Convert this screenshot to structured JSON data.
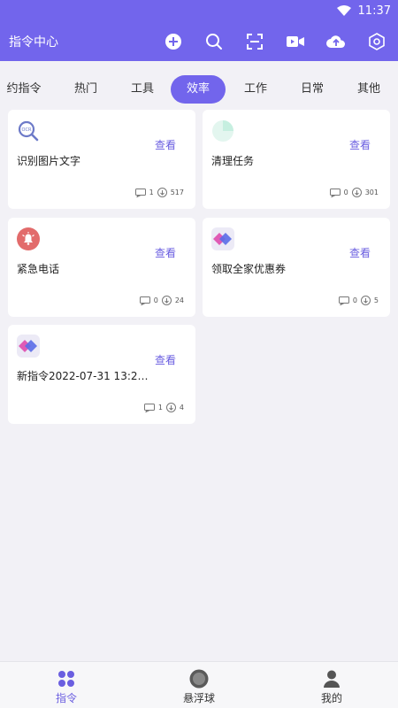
{
  "status_bar": {
    "time": "11:37",
    "wifi_icon": "wifi-icon"
  },
  "header": {
    "title": "指令中心",
    "icons": [
      "add-icon",
      "search-icon",
      "scan-icon",
      "video-icon",
      "cloud-upload-icon",
      "settings-icon"
    ]
  },
  "tabs": [
    {
      "label": "约指令"
    },
    {
      "label": "热门"
    },
    {
      "label": "工具"
    },
    {
      "label": "效率",
      "active": true
    },
    {
      "label": "工作"
    },
    {
      "label": "日常"
    },
    {
      "label": "其他"
    }
  ],
  "cards": [
    {
      "name": "识别图片文字",
      "view_label": "查看",
      "comments": "1",
      "downloads": "517",
      "icon": "ocr-magnifier-icon"
    },
    {
      "name": "清理任务",
      "view_label": "查看",
      "comments": "0",
      "downloads": "301",
      "icon": "cleanup-icon"
    },
    {
      "name": "紧急电话",
      "view_label": "查看",
      "comments": "0",
      "downloads": "24",
      "icon": "alarm-bell-icon"
    },
    {
      "name": "领取全家优惠券",
      "view_label": "查看",
      "comments": "0",
      "downloads": "5",
      "icon": "app-logo-icon"
    },
    {
      "name": "新指令2022-07-31 13:20:...",
      "view_label": "查看",
      "comments": "1",
      "downloads": "4",
      "icon": "app-logo-icon"
    }
  ],
  "bottom_nav": [
    {
      "label": "指令",
      "active": true
    },
    {
      "label": "悬浮球"
    },
    {
      "label": "我的"
    }
  ],
  "colors": {
    "accent": "#7265ec",
    "background": "#f2f1f6"
  }
}
